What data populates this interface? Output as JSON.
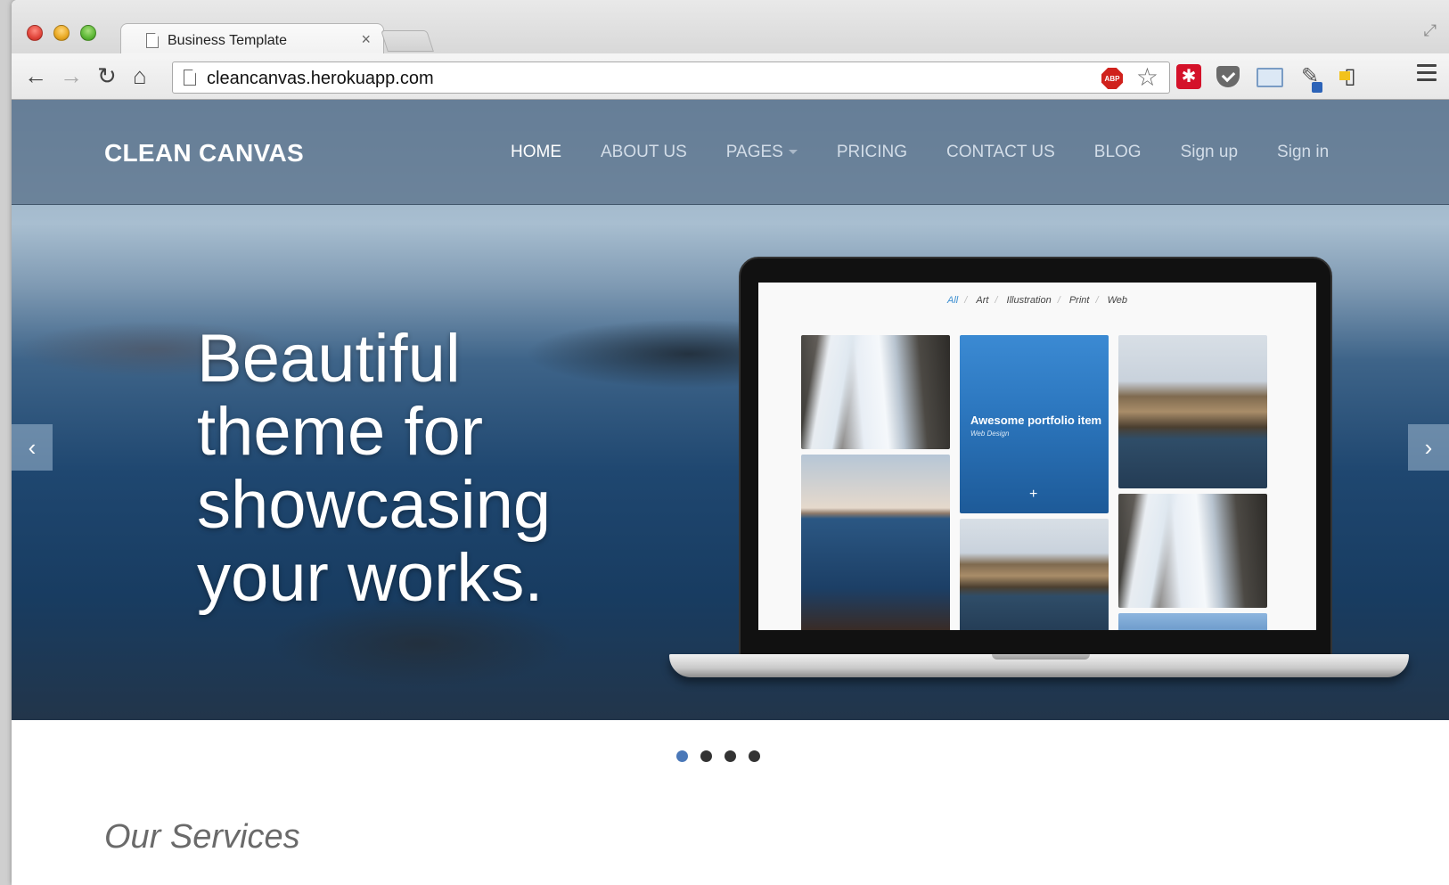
{
  "browser": {
    "tab_title": "Business Template",
    "tab_close": "×",
    "url": "cleancanvas.herokuapp.com",
    "abp_label": "ABP",
    "icons": [
      "back-arrow-icon",
      "forward-arrow-icon",
      "reload-icon",
      "home-icon",
      "bookmark-star-icon",
      "adblock-icon",
      "lastpass-icon",
      "pocket-icon",
      "screenshot-icon",
      "color-picker-icon",
      "signout-icon",
      "menu-icon"
    ]
  },
  "site": {
    "brand": "CLEAN CANVAS",
    "nav": {
      "home": "HOME",
      "about": "ABOUT US",
      "pages": "PAGES",
      "pricing": "PRICING",
      "contact": "CONTACT US",
      "blog": "BLOG",
      "signup": "Sign up",
      "signin": "Sign in"
    },
    "hero": {
      "line1": "Beautiful",
      "line2": "theme for",
      "line3": "showcasing",
      "line4": "your works.",
      "prev": "‹",
      "next": "›"
    },
    "portfolio": {
      "filters": [
        "All",
        "Art",
        "Illustration",
        "Print",
        "Web"
      ],
      "featured_title": "Awesome portfolio item",
      "featured_subtitle": "Web Design",
      "plus": "+"
    },
    "carousel": {
      "slides": 4,
      "active": 1
    },
    "services_title": "Our Services"
  },
  "colors": {
    "accent": "#4a78b8",
    "header_bg": "#566e87",
    "filter_active": "#3d8fd1"
  }
}
